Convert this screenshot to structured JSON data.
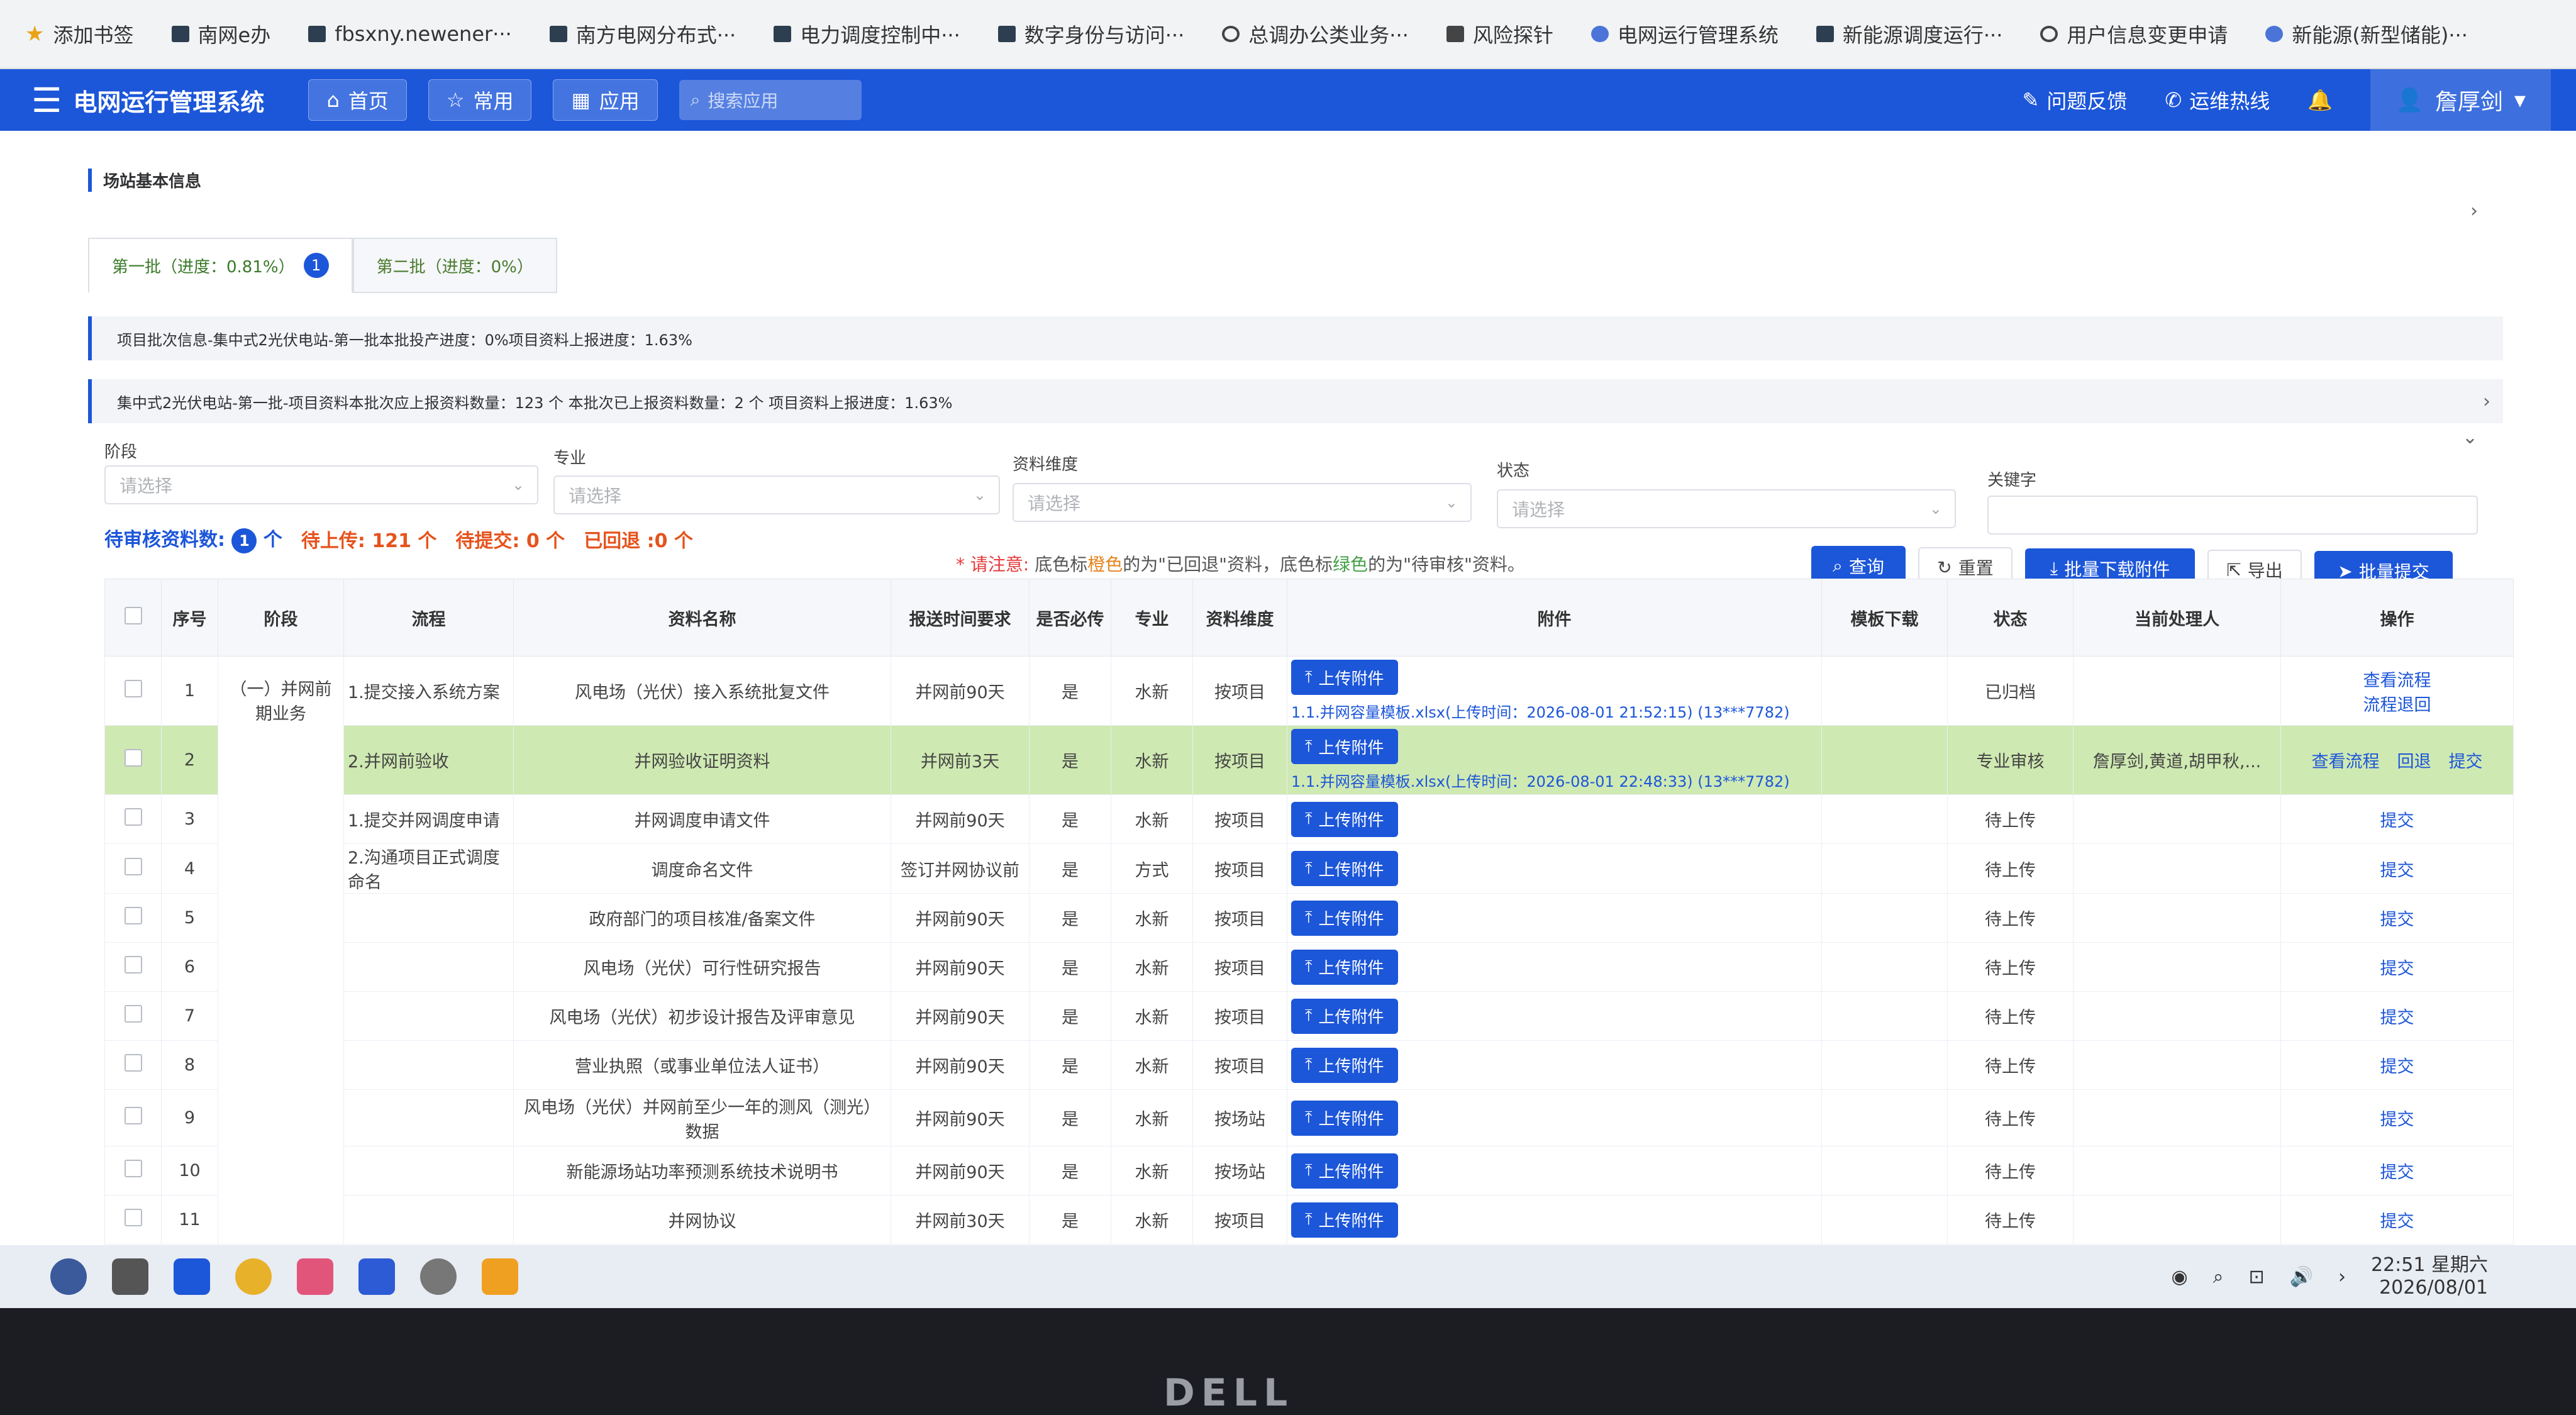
{
  "bookmarks": [
    {
      "icon": "star-icon",
      "label": "添加书签"
    },
    {
      "icon": "doc-icon",
      "label": "南网e办"
    },
    {
      "icon": "doc-icon",
      "label": "fbsxny.newener···"
    },
    {
      "icon": "doc-icon",
      "label": "南方电网分布式···"
    },
    {
      "icon": "doc-icon",
      "label": "电力调度控制中···"
    },
    {
      "icon": "doc-icon",
      "label": "数字身份与访问···"
    },
    {
      "icon": "globe-icon",
      "label": "总调办公类业务···"
    },
    {
      "icon": "folder-icon",
      "label": "风险探针"
    },
    {
      "icon": "app-icon",
      "label": "电网运行管理系统"
    },
    {
      "icon": "doc-icon",
      "label": "新能源调度运行···"
    },
    {
      "icon": "globe-icon",
      "label": "用户信息变更申请"
    },
    {
      "icon": "app-icon",
      "label": "新能源(新型储能)···"
    }
  ],
  "header": {
    "title": "电网运行管理系统",
    "home": "首页",
    "common": "常用",
    "apps": "应用",
    "search_placeholder": "搜索应用",
    "feedback": "问题反馈",
    "hotline": "运维热线",
    "user": "詹厚剑"
  },
  "section": {
    "title": "场站基本信息"
  },
  "tabs": [
    {
      "label": "第一批（进度：0.81%）",
      "badge": "1"
    },
    {
      "label": "第二批（进度：0%）"
    }
  ],
  "info": {
    "line1": "项目批次信息-集中式2光伏电站-第一批本批投产进度：0%项目资料上报进度：1.63%",
    "line2": "集中式2光伏电站-第一批-项目资料本批次应上报资料数量：123 个 本批次已上报资料数量：2 个 项目资料上报进度：1.63%"
  },
  "filters": {
    "stage": {
      "label": "阶段",
      "placeholder": "请选择"
    },
    "major": {
      "label": "专业",
      "placeholder": "请选择"
    },
    "dimension": {
      "label": "资料维度",
      "placeholder": "请选择"
    },
    "status": {
      "label": "状态",
      "placeholder": "请选择"
    },
    "keyword": {
      "label": "关键字",
      "placeholder": ""
    }
  },
  "counts": {
    "pending_review_label": "待审核资料数:",
    "pending_review_value": "1",
    "unit": "个",
    "to_upload": "待上传: 121 个",
    "to_submit": "待提交: 0 个",
    "returned": "已回退 :0 个"
  },
  "note": {
    "prefix": "* 请注意:",
    "text1": "底色标",
    "orange": "橙色",
    "text2": "的为\"已回退\"资料，底色标",
    "green": "绿色",
    "text3": "的为\"待审核\"资料。"
  },
  "toolbar": {
    "query": "查询",
    "reset": "重置",
    "batch_download": "批量下载附件",
    "export": "导出",
    "batch_submit": "批量提交"
  },
  "table": {
    "headers": [
      "序号",
      "阶段",
      "流程",
      "资料名称",
      "报送时间要求",
      "是否必传",
      "专业",
      "资料维度",
      "附件",
      "模板下载",
      "状态",
      "当前处理人",
      "操作"
    ],
    "upload_label": "上传附件",
    "stage_group": "（一）并网前期业务",
    "rows": [
      {
        "no": "1",
        "process": "1.提交接入系统方案",
        "name": "风电场（光伏）接入系统批复文件",
        "time": "并网前90天",
        "required": "是",
        "major": "水新",
        "dim": "按项目",
        "file": "1.1.并网容量模板.xlsx(上传时间：2026-08-01 21:52:15) (13***7782)",
        "status": "已归档",
        "handler": "",
        "ops": [
          "查看流程",
          "流程退回"
        ],
        "green": false
      },
      {
        "no": "2",
        "process": "2.并网前验收",
        "name": "并网验收证明资料",
        "time": "并网前3天",
        "required": "是",
        "major": "水新",
        "dim": "按项目",
        "file": "1.1.并网容量模板.xlsx(上传时间：2026-08-01 22:48:33) (13***7782)",
        "status": "专业审核",
        "handler": "詹厚剑,黄道,胡甲秋,...",
        "ops": [
          "查看流程",
          "回退",
          "提交"
        ],
        "green": true
      },
      {
        "no": "3",
        "process": "1.提交并网调度申请",
        "name": "并网调度申请文件",
        "time": "并网前90天",
        "required": "是",
        "major": "水新",
        "dim": "按项目",
        "file": "",
        "status": "待上传",
        "handler": "",
        "ops": [
          "提交"
        ],
        "green": false
      },
      {
        "no": "4",
        "process": "2.沟通项目正式调度命名",
        "name": "调度命名文件",
        "time": "签订并网协议前",
        "required": "是",
        "major": "方式",
        "dim": "按项目",
        "file": "",
        "status": "待上传",
        "handler": "",
        "ops": [
          "提交"
        ],
        "green": false
      },
      {
        "no": "5",
        "process": "",
        "name": "政府部门的项目核准/备案文件",
        "time": "并网前90天",
        "required": "是",
        "major": "水新",
        "dim": "按项目",
        "file": "",
        "status": "待上传",
        "handler": "",
        "ops": [
          "提交"
        ],
        "green": false
      },
      {
        "no": "6",
        "process": "",
        "name": "风电场（光伏）可行性研究报告",
        "time": "并网前90天",
        "required": "是",
        "major": "水新",
        "dim": "按项目",
        "file": "",
        "status": "待上传",
        "handler": "",
        "ops": [
          "提交"
        ],
        "green": false
      },
      {
        "no": "7",
        "process": "",
        "name": "风电场（光伏）初步设计报告及评审意见",
        "time": "并网前90天",
        "required": "是",
        "major": "水新",
        "dim": "按项目",
        "file": "",
        "status": "待上传",
        "handler": "",
        "ops": [
          "提交"
        ],
        "green": false
      },
      {
        "no": "8",
        "process": "",
        "name": "营业执照（或事业单位法人证书）",
        "time": "并网前90天",
        "required": "是",
        "major": "水新",
        "dim": "按项目",
        "file": "",
        "status": "待上传",
        "handler": "",
        "ops": [
          "提交"
        ],
        "green": false
      },
      {
        "no": "9",
        "process": "",
        "name": "风电场（光伏）并网前至少一年的测风（测光）数据",
        "time": "并网前90天",
        "required": "是",
        "major": "水新",
        "dim": "按场站",
        "file": "",
        "status": "待上传",
        "handler": "",
        "ops": [
          "提交"
        ],
        "green": false
      },
      {
        "no": "10",
        "process": "",
        "name": "新能源场站功率预测系统技术说明书",
        "time": "并网前90天",
        "required": "是",
        "major": "水新",
        "dim": "按场站",
        "file": "",
        "status": "待上传",
        "handler": "",
        "ops": [
          "提交"
        ],
        "green": false
      },
      {
        "no": "11",
        "process": "",
        "name": "并网协议",
        "time": "并网前30天",
        "required": "是",
        "major": "水新",
        "dim": "按项目",
        "file": "",
        "status": "待上传",
        "handler": "",
        "ops": [
          "提交"
        ],
        "green": false
      }
    ]
  },
  "taskbar": {
    "time": "22:51 星期六",
    "date": "2026/08/01"
  },
  "bezel": {
    "brand": "DELL"
  }
}
